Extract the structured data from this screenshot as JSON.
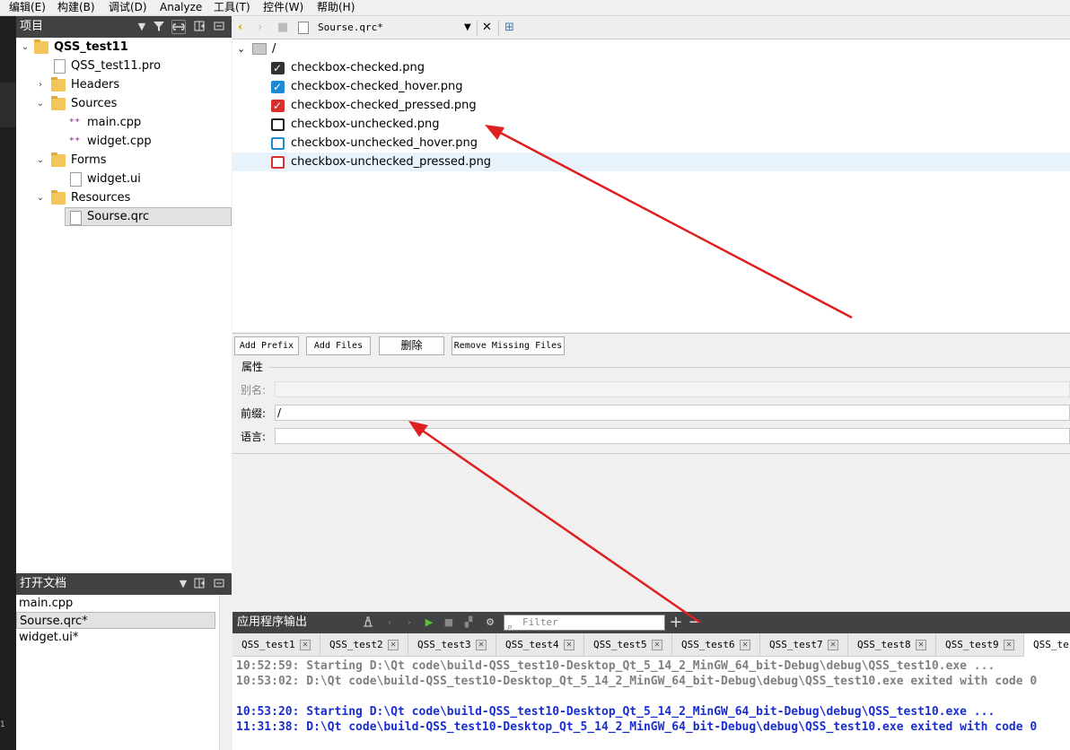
{
  "menubar": {
    "items": [
      "编辑(E)",
      "构建(B)",
      "调试(D)",
      "Analyze",
      "工具(T)",
      "控件(W)",
      "帮助(H)"
    ]
  },
  "leftrail": {
    "number": "1"
  },
  "project_panel": {
    "title": "项目",
    "tree": [
      {
        "label": "QSS_test11",
        "icon": "project-folder-icon"
      },
      {
        "label": "QSS_test11.pro",
        "icon": "pro-file-icon"
      },
      {
        "label": "Headers",
        "icon": "headers-folder-icon"
      },
      {
        "label": "Sources",
        "icon": "sources-folder-icon"
      },
      {
        "label": "main.cpp",
        "icon": "cpp-file-icon"
      },
      {
        "label": "widget.cpp",
        "icon": "cpp-file-icon"
      },
      {
        "label": "Forms",
        "icon": "forms-folder-icon"
      },
      {
        "label": "widget.ui",
        "icon": "ui-file-icon"
      },
      {
        "label": "Resources",
        "icon": "resources-folder-icon"
      },
      {
        "label": "Sourse.qrc",
        "icon": "qrc-file-icon"
      }
    ]
  },
  "open_docs": {
    "title": "打开文档",
    "items": [
      "main.cpp",
      "Sourse.qrc*",
      "widget.ui*"
    ]
  },
  "editor": {
    "filename": "Sourse.qrc*",
    "root_prefix": "/",
    "files": [
      {
        "name": "checkbox-checked.png",
        "icon": "checkbox-checked-icon",
        "color": "#333333"
      },
      {
        "name": "checkbox-checked_hover.png",
        "icon": "checkbox-checked-hover-icon",
        "color": "#1a8ad4"
      },
      {
        "name": "checkbox-checked_pressed.png",
        "icon": "checkbox-checked-pressed-icon",
        "color": "#d9302b"
      },
      {
        "name": "checkbox-unchecked.png",
        "icon": "checkbox-unchecked-icon",
        "color": "#222222"
      },
      {
        "name": "checkbox-unchecked_hover.png",
        "icon": "checkbox-unchecked-hover-icon",
        "color": "#1a8ad4"
      },
      {
        "name": "checkbox-unchecked_pressed.png",
        "icon": "checkbox-unchecked-pressed-icon",
        "color": "#d9302b"
      }
    ],
    "buttons": {
      "add_prefix": "Add Prefix",
      "add_files": "Add Files",
      "delete": "删除",
      "remove_missing": "Remove Missing Files"
    },
    "properties": {
      "title": "属性",
      "alias_label": "别名:",
      "alias_value": "",
      "prefix_label": "前缀:",
      "prefix_value": "/",
      "language_label": "语言:",
      "language_value": ""
    }
  },
  "output": {
    "title": "应用程序输出",
    "filter_placeholder": "Filter",
    "tabs": [
      "QSS_test1",
      "QSS_test2",
      "QSS_test3",
      "QSS_test4",
      "QSS_test5",
      "QSS_test6",
      "QSS_test7",
      "QSS_test8",
      "QSS_test9",
      "QSS_tes"
    ],
    "lines": [
      {
        "text": "10:52:59: Starting D:\\Qt code\\build-QSS_test10-Desktop_Qt_5_14_2_MinGW_64_bit-Debug\\debug\\QSS_test10.exe ...",
        "color": "#808080"
      },
      {
        "text": "10:53:02: D:\\Qt code\\build-QSS_test10-Desktop_Qt_5_14_2_MinGW_64_bit-Debug\\debug\\QSS_test10.exe exited with code 0",
        "color": "#808080"
      },
      {
        "text": "",
        "color": "#808080"
      },
      {
        "text": "10:53:20: Starting D:\\Qt code\\build-QSS_test10-Desktop_Qt_5_14_2_MinGW_64_bit-Debug\\debug\\QSS_test10.exe ...",
        "color": "#1a2ed0"
      },
      {
        "text": "11:31:38: D:\\Qt code\\build-QSS_test10-Desktop_Qt_5_14_2_MinGW_64_bit-Debug\\debug\\QSS_test10.exe exited with code 0",
        "color": "#1a2ed0"
      }
    ]
  },
  "colors": {
    "panel_header": "#404244",
    "annotation_arrow": "#e02020",
    "selection": "#e8f2fb"
  }
}
